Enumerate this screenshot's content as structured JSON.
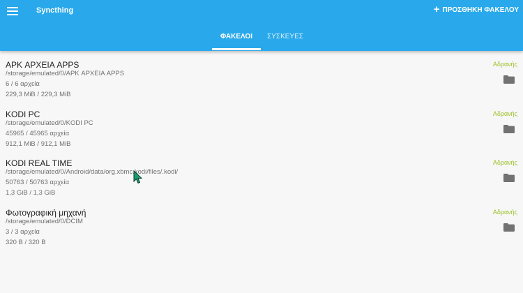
{
  "app": {
    "title": "Syncthing",
    "add_folder_label": "ΠΡΟΣΘΗΚΗ ΦΑΚΕΛΟΥ",
    "accent_color": "#29a9eb",
    "status_color": "#9bbf22"
  },
  "tabs": [
    {
      "label": "ΦΑΚΕΛΟΙ",
      "active": true
    },
    {
      "label": "ΣΥΣΚΕΥΕΣ",
      "active": false
    }
  ],
  "folders": [
    {
      "name": "APK ΑΡΧΕΙΑ APPS",
      "path": "/storage/emulated/0/APK ΑΡΧΕΙΑ APPS",
      "files": "6 / 6 αρχεία",
      "size": "229,3 MiB / 229,3 MiB",
      "status": "Αδρανής",
      "icon": "folder-icon"
    },
    {
      "name": "KODI PC",
      "path": "/storage/emulated/0/KODI PC",
      "files": "45965 / 45965 αρχεία",
      "size": "912,1 MiB / 912,1 MiB",
      "status": "Αδρανής",
      "icon": "folder-icon"
    },
    {
      "name": "KODI REAL TIME",
      "path": "/storage/emulated/0/Android/data/org.xbmc.kodi/files/.kodi/",
      "files": "50763 / 50763 αρχεία",
      "size": "1,3 GiB / 1,3 GiB",
      "status": "Αδρανής",
      "icon": "folder-icon"
    },
    {
      "name": "Φωτογραφική μηχανή",
      "path": "/storage/emulated/0/DCIM",
      "files": "3 / 3 αρχεία",
      "size": "320 B / 320 B",
      "status": "Αδρανής",
      "icon": "folder-icon"
    }
  ]
}
